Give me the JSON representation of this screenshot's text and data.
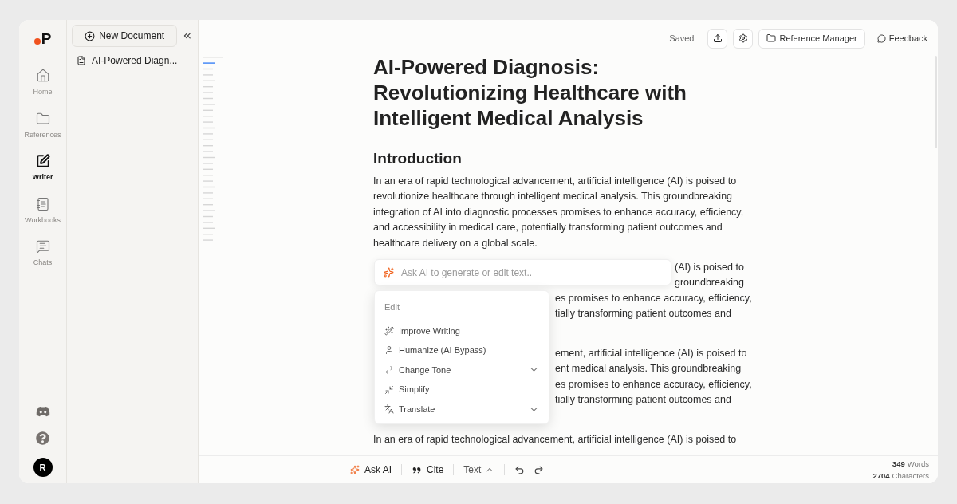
{
  "rail": {
    "logo": "P",
    "items": [
      {
        "label": "Home",
        "kind": "home",
        "selected": false
      },
      {
        "label": "References",
        "kind": "folder",
        "selected": false
      },
      {
        "label": "Writer",
        "kind": "writer",
        "selected": true
      },
      {
        "label": "Workbooks",
        "kind": "workbook",
        "selected": false
      },
      {
        "label": "Chats",
        "kind": "chat",
        "selected": false
      }
    ],
    "avatar": "R"
  },
  "sidebar": {
    "new_button": "New Document",
    "documents": [
      "AI-Powered Diagn..."
    ]
  },
  "toolbar": {
    "status": "Saved",
    "reference_button": "Reference Manager",
    "feedback": "Feedback"
  },
  "document": {
    "title_lines": [
      "AI-Powered Diagnosis:",
      "Revolutionizing Healthcare with",
      "Intelligent Medical Analysis"
    ],
    "heading": "Introduction",
    "paragraphs": [
      {
        "kind": "full",
        "lines": [
          "In an era of rapid technological advancement, artificial intelligence (AI) is poised to",
          "revolutionize healthcare through intelligent medical analysis. This groundbreaking",
          "integration of AI into diagnostic processes promises to enhance accuracy, efficiency,",
          "and accessibility in medical care, potentially transforming patient outcomes and",
          "healthcare delivery on a global scale."
        ]
      },
      {
        "kind": "partial",
        "lines": [
          "(AI) is poised to",
          "groundbreaking",
          "es promises to enhance accuracy, efficiency,",
          "tially transforming patient outcomes and"
        ]
      },
      {
        "kind": "partial",
        "lines": [
          "ement, artificial intelligence (AI) is poised to",
          "ent medical analysis. This groundbreaking",
          "es promises to enhance accuracy, efficiency,",
          "tially transforming patient outcomes and"
        ]
      },
      {
        "kind": "full",
        "lines": [
          "In an era of rapid technological advancement, artificial intelligence (AI) is poised to"
        ]
      }
    ]
  },
  "ai_prompt": {
    "placeholder": "Ask AI to generate or edit text.."
  },
  "ai_menu": {
    "section": "Edit",
    "items": [
      {
        "label": "Improve Writing",
        "kind": "wand",
        "submenu": false
      },
      {
        "label": "Humanize (AI Bypass)",
        "kind": "person",
        "submenu": false
      },
      {
        "label": "Change Tone",
        "kind": "swap",
        "submenu": true
      },
      {
        "label": "Simplify",
        "kind": "shrink",
        "submenu": false
      },
      {
        "label": "Translate",
        "kind": "translate",
        "submenu": true
      }
    ]
  },
  "bottom_bar": {
    "ask_ai": "Ask AI",
    "cite": "Cite",
    "format": "Text",
    "counts": [
      {
        "value": "349",
        "label": "Words"
      },
      {
        "value": "2704",
        "label": "Characters"
      }
    ]
  }
}
